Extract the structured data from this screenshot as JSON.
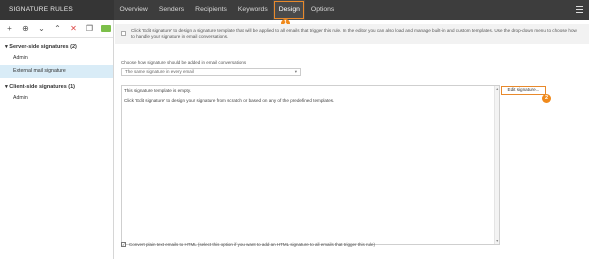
{
  "app": {
    "title": "SIGNATURE RULES"
  },
  "nav": {
    "tabs": [
      {
        "label": "Overview"
      },
      {
        "label": "Senders"
      },
      {
        "label": "Recipients"
      },
      {
        "label": "Keywords"
      },
      {
        "label": "Design"
      },
      {
        "label": "Options"
      }
    ],
    "active_tab": "Design"
  },
  "badges": {
    "one": "1",
    "two": "2"
  },
  "sidebar": {
    "toolbar_icons": [
      "add-icon",
      "add-rule-icon",
      "chevron-down-icon",
      "chevron-up-icon",
      "delete-icon",
      "copy-icon",
      "toggle-icon"
    ],
    "groups": [
      {
        "label": "Server-side signatures (2)",
        "items": [
          "Admin",
          "External mail signature"
        ]
      },
      {
        "label": "Client-side signatures (1)",
        "items": [
          "Admin"
        ]
      }
    ],
    "selected_item": "External mail signature"
  },
  "main": {
    "hint": "Click 'Edit signature' to design a signature template that will be applied to all emails that trigger this rule. In the editor you can also load and manage built-in and custom templates. Use the drop-down menu to choose how to handle your signature in email conversations.",
    "choose_label": "Choose how signature should be added in email conversations",
    "select_value": "The same signature in every email",
    "editor_lines": [
      "This signature template is empty.",
      "Click 'Edit signature' to design your signature from scratch or based on any of the predefined templates."
    ],
    "edit_button": "Edit signature...",
    "footer": "Convert plain text emails to HTML (select this option if you want to add an HTML signature to all emails that trigger this rule)"
  },
  "colors": {
    "accent": "#e8892b",
    "topbar": "#3d3d3d",
    "selected": "#d9ecf7"
  }
}
